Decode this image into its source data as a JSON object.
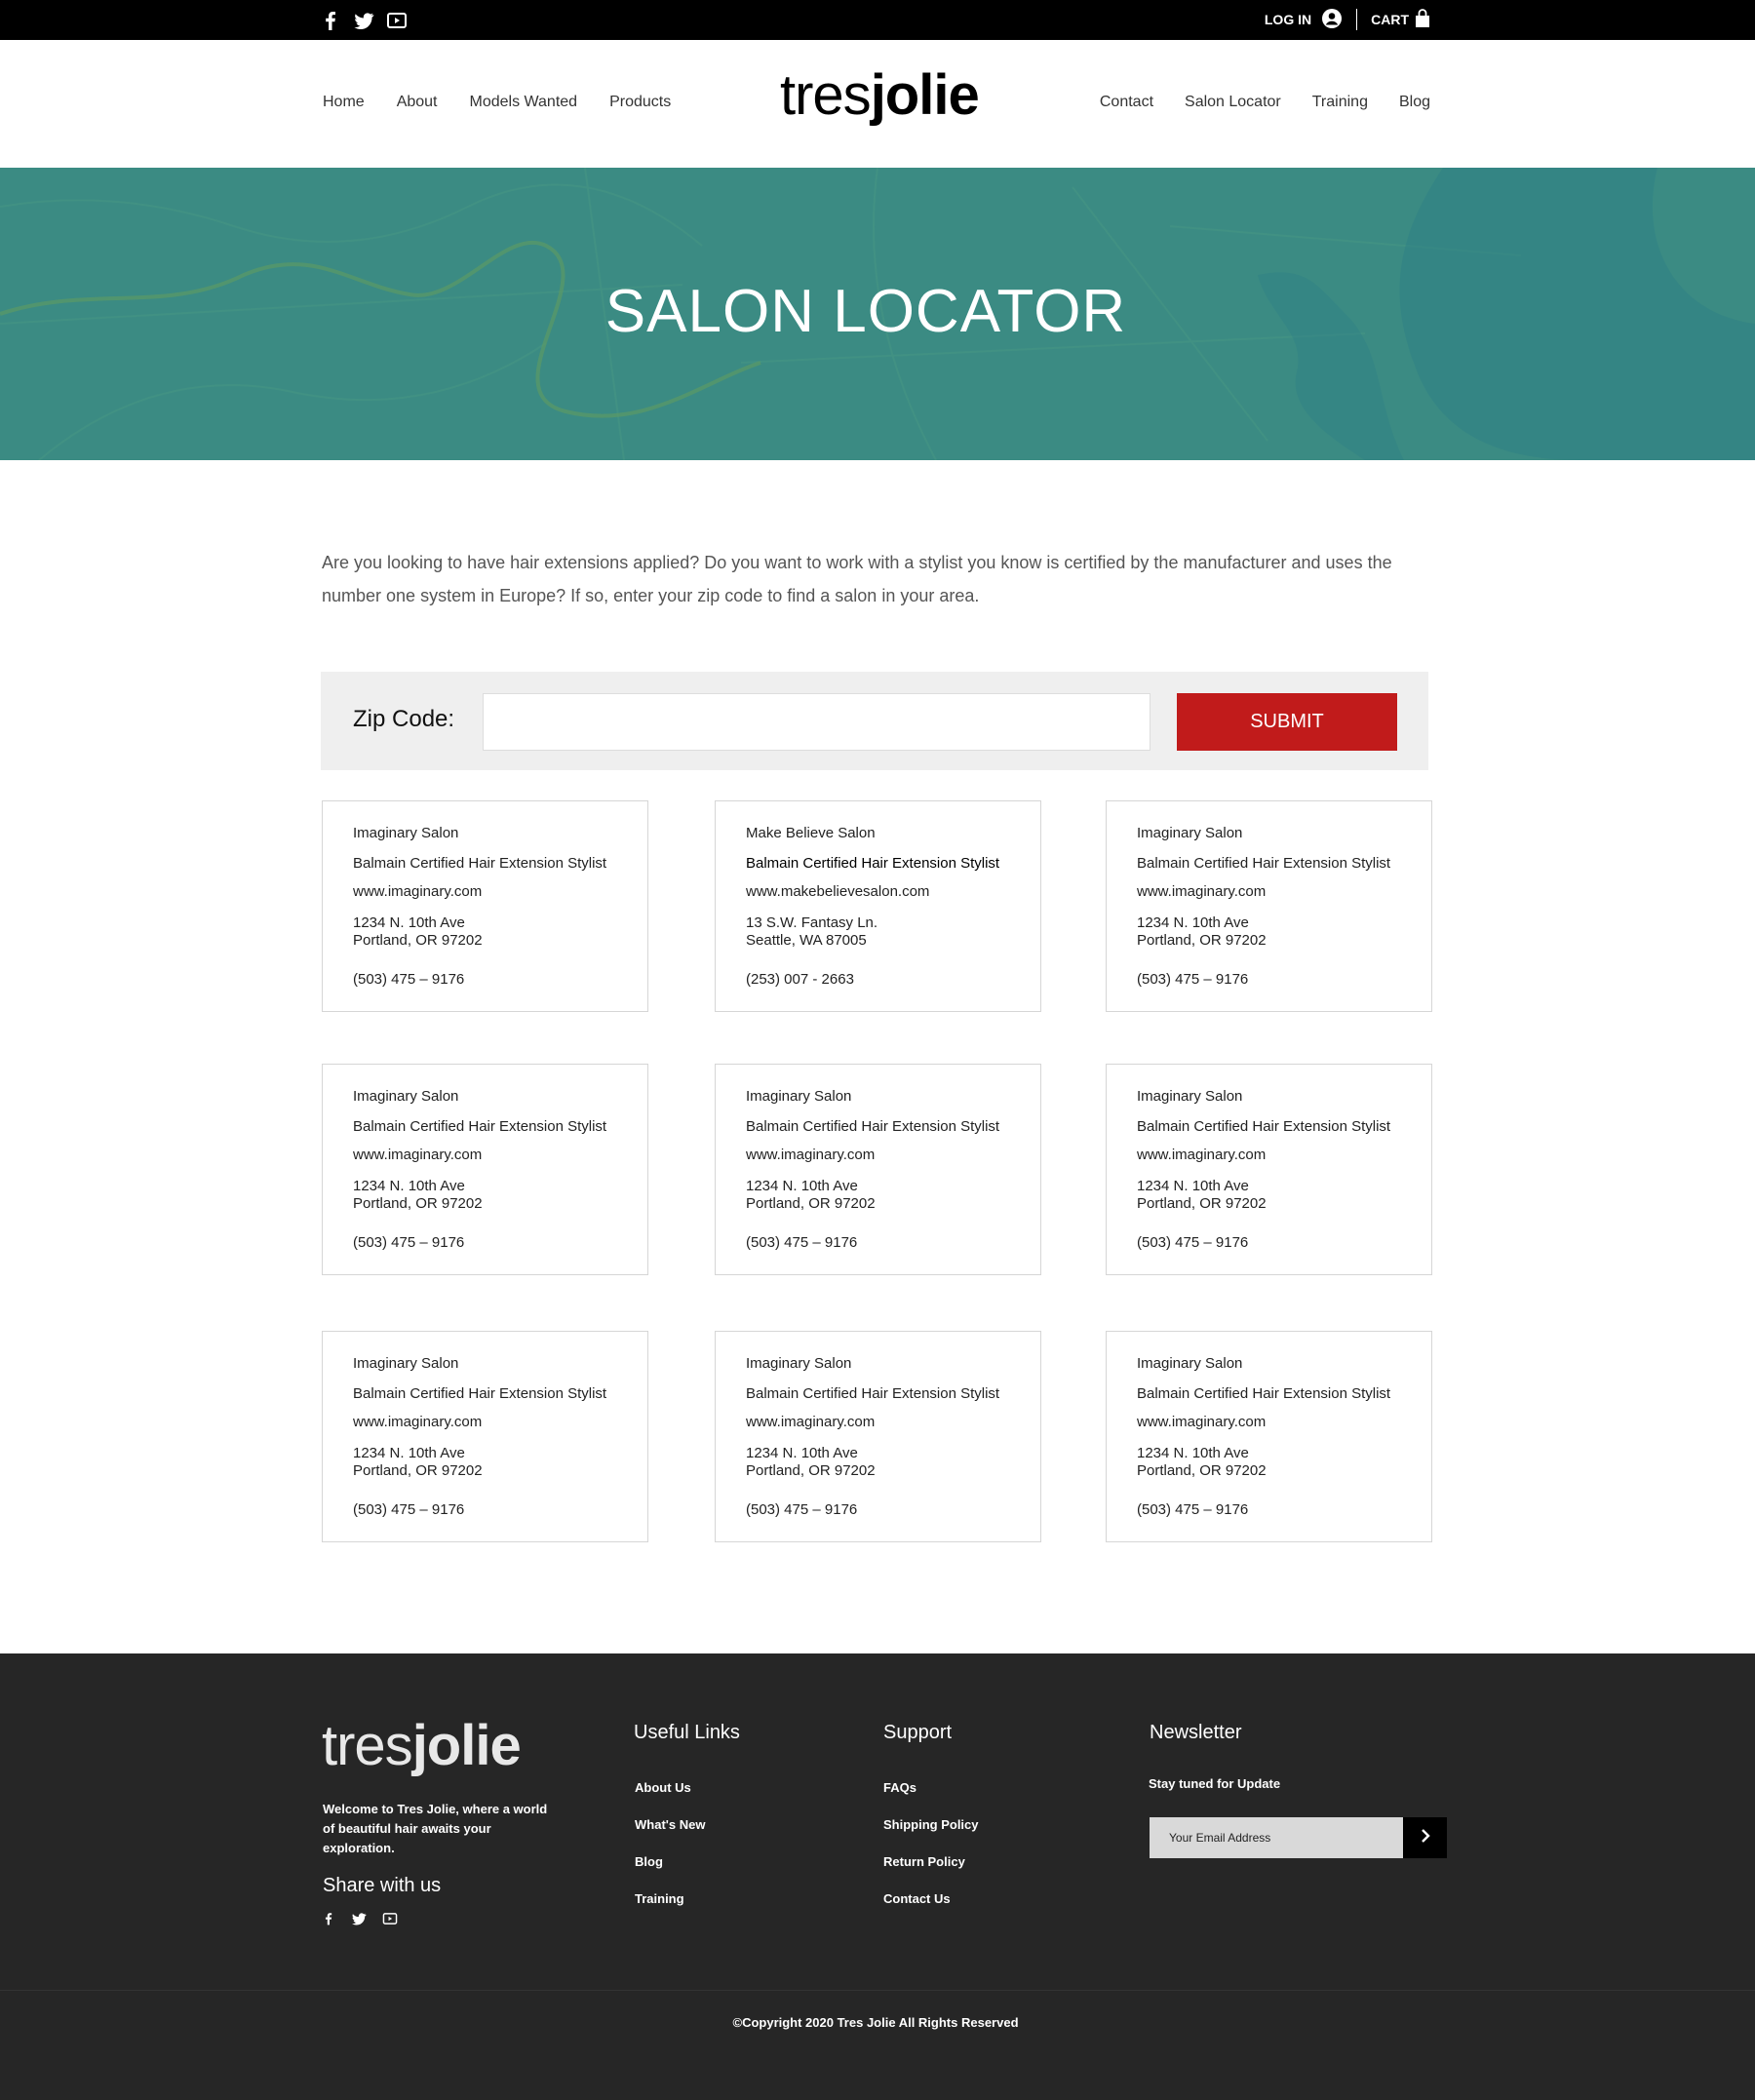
{
  "topbar": {
    "social_icons": [
      "facebook-icon",
      "twitter-icon",
      "youtube-icon"
    ],
    "login_label": "LOG IN",
    "cart_label": "CART"
  },
  "header": {
    "logo_light": "tres",
    "logo_bold": "jolie",
    "nav_left": [
      "Home",
      "About",
      "Models Wanted",
      "Products"
    ],
    "nav_right": [
      "Contact",
      "Salon Locator",
      "Training",
      "Blog"
    ]
  },
  "hero": {
    "title": "SALON LOCATOR"
  },
  "intro": {
    "text": "Are you looking to have hair extensions applied? Do you want to work with a stylist you know is certified by the manufacturer and uses the number one system in Europe? If so, enter your zip code to find a salon in your area."
  },
  "zip_form": {
    "label": "Zip Code:",
    "value": "",
    "submit_label": "SUBMIT"
  },
  "salons": [
    {
      "name": "Imaginary Salon",
      "cert": "Balmain Certified Hair Extension Stylist",
      "url": "www.imaginary.com",
      "addr1": "1234 N. 10th Ave",
      "addr2": "Portland, OR 97202",
      "phone": "(503) 475 – 9176"
    },
    {
      "name": "Make Believe Salon",
      "cert": "Balmain Certified Hair Extension Stylist",
      "url": "www.makebelievesalon.com",
      "addr1": "13 S.W. Fantasy Ln.",
      "addr2": "Seattle, WA 87005",
      "phone": "(253) 007 - 2663"
    },
    {
      "name": "Imaginary Salon",
      "cert": "Balmain Certified Hair Extension Stylist",
      "url": "www.imaginary.com",
      "addr1": "1234 N. 10th Ave",
      "addr2": "Portland, OR 97202",
      "phone": "(503) 475 – 9176"
    },
    {
      "name": "Imaginary Salon",
      "cert": "Balmain Certified Hair Extension Stylist",
      "url": "www.imaginary.com",
      "addr1": "1234 N. 10th Ave",
      "addr2": "Portland, OR 97202",
      "phone": "(503) 475 – 9176"
    },
    {
      "name": "Imaginary Salon",
      "cert": "Balmain Certified Hair Extension Stylist",
      "url": "www.imaginary.com",
      "addr1": "1234 N. 10th Ave",
      "addr2": "Portland, OR 97202",
      "phone": "(503) 475 – 9176"
    },
    {
      "name": "Imaginary Salon",
      "cert": "Balmain Certified Hair Extension Stylist",
      "url": "www.imaginary.com",
      "addr1": "1234 N. 10th Ave",
      "addr2": "Portland, OR 97202",
      "phone": "(503) 475 – 9176"
    },
    {
      "name": "Imaginary Salon",
      "cert": "Balmain Certified Hair Extension Stylist",
      "url": "www.imaginary.com",
      "addr1": "1234 N. 10th Ave",
      "addr2": "Portland, OR 97202",
      "phone": "(503) 475 – 9176"
    },
    {
      "name": "Imaginary Salon",
      "cert": "Balmain Certified Hair Extension Stylist",
      "url": "www.imaginary.com",
      "addr1": "1234 N. 10th Ave",
      "addr2": "Portland, OR 97202",
      "phone": "(503) 475 – 9176"
    },
    {
      "name": "Imaginary Salon",
      "cert": "Balmain Certified Hair Extension Stylist",
      "url": "www.imaginary.com",
      "addr1": "1234 N. 10th Ave",
      "addr2": "Portland, OR 97202",
      "phone": "(503) 475 – 9176"
    }
  ],
  "footer": {
    "logo_light": "tres",
    "logo_bold": "jolie",
    "welcome": "Welcome to Tres Jolie, where a world of beautiful hair awaits your exploration.",
    "share_title": "Share with us",
    "useful_links_title": "Useful Links",
    "useful_links": [
      "About Us",
      "What's New",
      "Blog",
      "Training"
    ],
    "support_title": "Support",
    "support_links": [
      "FAQs",
      "Shipping Policy",
      "Return Policy",
      "Contact Us"
    ],
    "newsletter_title": "Newsletter",
    "newsletter_text": "Stay tuned for Update",
    "email_placeholder": "Your Email Address",
    "copyright": "©Copyright 2020 Tres Jolie All Rights Reserved"
  },
  "colors": {
    "topbar_bg": "#000000",
    "hero_bg": "#3f8b80",
    "submit_bg": "#c11b1b",
    "footer_bg": "#262626"
  }
}
